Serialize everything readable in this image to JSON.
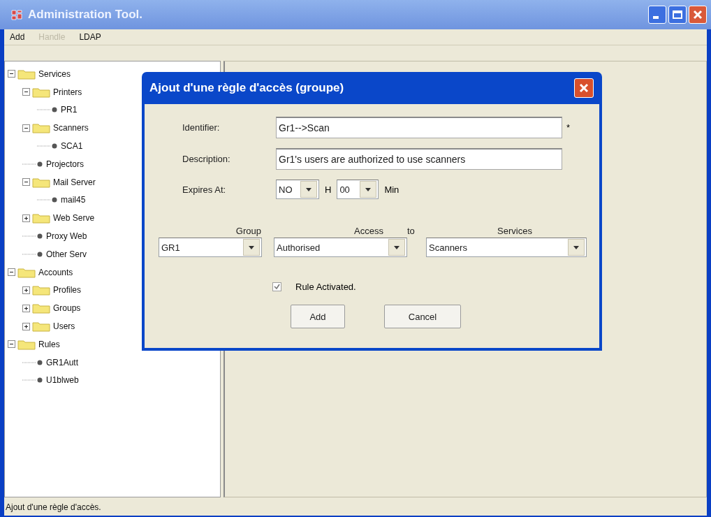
{
  "window": {
    "title": "Administration Tool."
  },
  "menu": [
    {
      "label": "Add",
      "disabled": false
    },
    {
      "label": "Handle",
      "disabled": true
    },
    {
      "label": "LDAP",
      "disabled": false
    }
  ],
  "tree": [
    {
      "kind": "folder",
      "label": "Services",
      "expanded": true,
      "children": [
        {
          "kind": "folder",
          "label": "Printers",
          "expanded": true,
          "children": [
            {
              "kind": "leaf",
              "label": "PR1"
            }
          ]
        },
        {
          "kind": "folder",
          "label": "Scanners",
          "expanded": true,
          "children": [
            {
              "kind": "leaf",
              "label": "SCA1"
            }
          ]
        },
        {
          "kind": "leaf",
          "label": "Projectors"
        },
        {
          "kind": "folder",
          "label": "Mail Server",
          "expanded": true,
          "children": [
            {
              "kind": "leaf",
              "label": "mail45"
            }
          ]
        },
        {
          "kind": "folder",
          "label": "Web Serve",
          "expanded": false
        },
        {
          "kind": "leaf",
          "label": "Proxy Web"
        },
        {
          "kind": "leaf",
          "label": "Other Serv"
        }
      ]
    },
    {
      "kind": "folder",
      "label": "Accounts",
      "expanded": true,
      "children": [
        {
          "kind": "folder",
          "label": "Profiles",
          "expanded": false
        },
        {
          "kind": "folder",
          "label": "Groups",
          "expanded": false
        },
        {
          "kind": "folder",
          "label": "Users",
          "expanded": false
        }
      ]
    },
    {
      "kind": "folder",
      "label": "Rules",
      "expanded": true,
      "children": [
        {
          "kind": "leaf",
          "label": "GR1Autt"
        },
        {
          "kind": "leaf",
          "label": "U1blweb"
        }
      ]
    }
  ],
  "dialog": {
    "title": "Ajout d'une règle d'accès (groupe)",
    "identifier": {
      "label": "Identifier:",
      "value": "Gr1-->Scan",
      "required_mark": "*"
    },
    "description": {
      "label": "Description:",
      "value": "Gr1's users are authorized to use scanners"
    },
    "expires": {
      "label": "Expires At:",
      "hour": "NO",
      "hour_unit": "H",
      "minute": "00",
      "minute_unit": "Min"
    },
    "rule_headers": [
      "Group",
      "Access",
      "to",
      "Services"
    ],
    "rule_values": [
      "GR1",
      "Authorised",
      "Scanners"
    ],
    "activated": {
      "label": "Rule Activated.",
      "checked": true
    },
    "buttons": [
      "Add",
      "Cancel"
    ]
  },
  "status_bar": "Ajout d'une règle d'accès."
}
